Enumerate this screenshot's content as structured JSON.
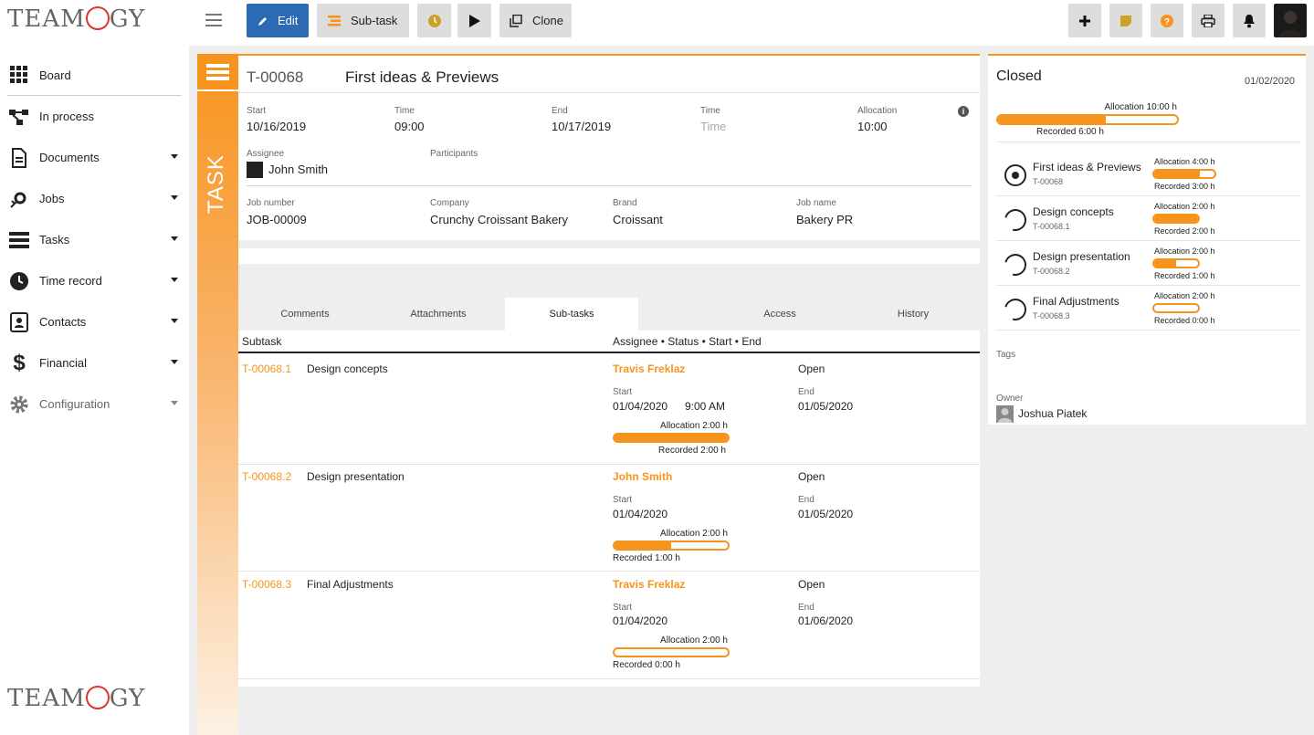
{
  "brand": {
    "logo_text": "TEAMOGY"
  },
  "nav": {
    "items": [
      {
        "label": "Board",
        "icon": "grid-icon"
      },
      {
        "label": "In process",
        "icon": "flow-icon"
      },
      {
        "label": "Documents",
        "icon": "document-icon"
      },
      {
        "label": "Jobs",
        "icon": "jobs-icon"
      },
      {
        "label": "Tasks",
        "icon": "tasks-icon"
      },
      {
        "label": "Time record",
        "icon": "clock-icon"
      },
      {
        "label": "Contacts",
        "icon": "contacts-icon"
      },
      {
        "label": "Financial",
        "icon": "dollar-icon"
      },
      {
        "label": "Configuration",
        "icon": "gear-icon"
      }
    ]
  },
  "toolbar": {
    "edit": "Edit",
    "subtask": "Sub-task",
    "clone": "Clone"
  },
  "task": {
    "band_label": "TASK",
    "id": "T-00068",
    "title": "First ideas & Previews",
    "start_label": "Start",
    "start": "10/16/2019",
    "time_label": "Time",
    "start_time": "09:00",
    "end_label": "End",
    "end": "10/17/2019",
    "time2_label": "Time",
    "end_time": "Time",
    "allocation_label": "Allocation",
    "allocation": "10:00",
    "assignee_label": "Assignee",
    "assignee": "John Smith",
    "participants_label": "Participants",
    "jobnumber_label": "Job number",
    "jobnumber": "JOB-00009",
    "company_label": "Company",
    "company": "Crunchy Croissant Bakery",
    "brand_label": "Brand",
    "brand": "Croissant",
    "jobname_label": "Job name",
    "jobname": "Bakery PR"
  },
  "tabs": [
    "Comments",
    "Attachments",
    "Sub-tasks",
    "Access",
    "History"
  ],
  "subtasks": {
    "col1": "Subtask",
    "col2": "Assignee • Status • Start • End",
    "start_label": "Start",
    "end_label": "End",
    "rows": [
      {
        "id": "T-00068.1",
        "name": "Design concepts",
        "assignee": "Travis Freklaz",
        "status": "Open",
        "start": "01/04/2020",
        "start_time": "9:00 AM",
        "end": "01/05/2020",
        "allocation": "Allocation 2:00 h",
        "recorded": "Recorded 2:00 h",
        "progress": 1.0
      },
      {
        "id": "T-00068.2",
        "name": "Design presentation",
        "assignee": "John Smith",
        "status": "Open",
        "start": "01/04/2020",
        "start_time": "",
        "end": "01/05/2020",
        "allocation": "Allocation 2:00 h",
        "recorded": "Recorded 1:00 h",
        "progress": 0.5
      },
      {
        "id": "T-00068.3",
        "name": "Final Adjustments",
        "assignee": "Travis Freklaz",
        "status": "Open",
        "start": "01/04/2020",
        "start_time": "",
        "end": "01/06/2020",
        "allocation": "Allocation 2:00 h",
        "recorded": "Recorded 0:00 h",
        "progress": 0.0
      }
    ]
  },
  "right": {
    "status": "Closed",
    "date": "01/02/2020",
    "allocation": "Allocation 10:00 h",
    "recorded": "Recorded 6:00 h",
    "progress": 0.6,
    "items": [
      {
        "name": "First ideas & Previews",
        "id": "T-00068",
        "allocation": "Allocation 4:00 h",
        "recorded": "Recorded 3:00 h",
        "progress": 0.75,
        "current": true
      },
      {
        "name": "Design concepts",
        "id": "T-00068.1",
        "allocation": "Allocation 2:00 h",
        "recorded": "Recorded 2:00 h",
        "progress": 1.0,
        "current": false
      },
      {
        "name": "Design presentation",
        "id": "T-00068.2",
        "allocation": "Allocation 2:00 h",
        "recorded": "Recorded 1:00 h",
        "progress": 0.5,
        "current": false
      },
      {
        "name": "Final Adjustments",
        "id": "T-00068.3",
        "allocation": "Allocation 2:00 h",
        "recorded": "Recorded 0:00 h",
        "progress": 0.0,
        "current": false
      }
    ],
    "tags_label": "Tags",
    "owner_label": "Owner",
    "owner": "Joshua Piatek"
  },
  "colors": {
    "accent": "#f7941d",
    "primary": "#2c6ab5"
  }
}
